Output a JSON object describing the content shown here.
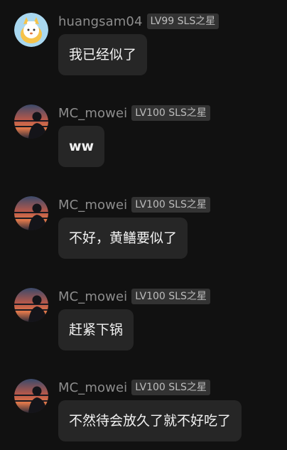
{
  "messages": [
    {
      "user": "huangsam04",
      "badge": "LV99 SLS之星",
      "text": "我已经似了",
      "avatar": "fox-avatar"
    },
    {
      "user": "MC_mowei",
      "badge": "LV100 SLS之星",
      "text": "ww",
      "avatar": "silhouette-sunset-avatar"
    },
    {
      "user": "MC_mowei",
      "badge": "LV100 SLS之星",
      "text": "不好，黄鳝要似了",
      "avatar": "silhouette-sunset-avatar"
    },
    {
      "user": "MC_mowei",
      "badge": "LV100 SLS之星",
      "text": "赶紧下锅",
      "avatar": "silhouette-sunset-avatar"
    },
    {
      "user": "MC_mowei",
      "badge": "LV100 SLS之星",
      "text": "不然待会放久了就不好吃了",
      "avatar": "silhouette-sunset-avatar"
    }
  ],
  "colors": {
    "background": "#111111",
    "bubble": "#262626",
    "username": "#8d8d8d",
    "badge_bg": "#333333"
  }
}
